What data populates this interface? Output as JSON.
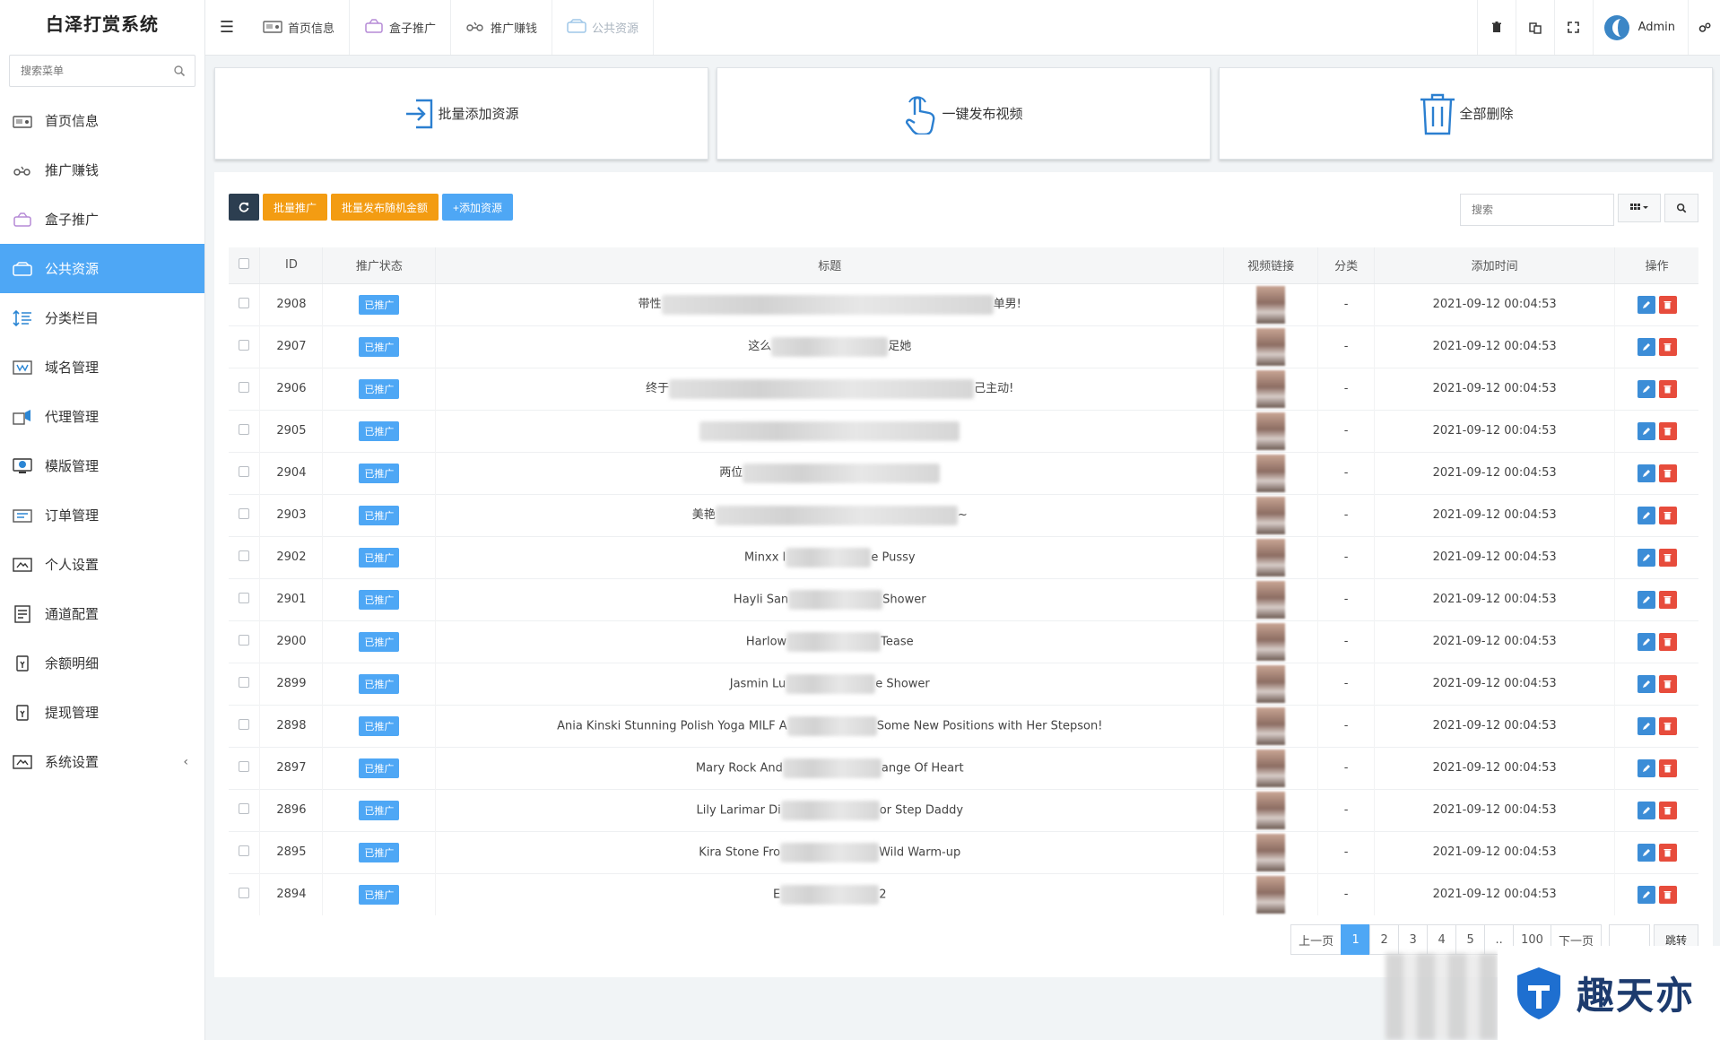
{
  "app": {
    "title": "白泽打赏系统"
  },
  "sidebar": {
    "search_placeholder": "搜索菜单",
    "items": [
      {
        "label": "首页信息",
        "icon": "dashboard-icon",
        "active": false
      },
      {
        "label": "推广赚钱",
        "icon": "promote-icon",
        "active": false
      },
      {
        "label": "盒子推广",
        "icon": "box-icon",
        "active": false
      },
      {
        "label": "公共资源",
        "icon": "resource-icon",
        "active": true
      },
      {
        "label": "分类栏目",
        "icon": "category-icon",
        "active": false
      },
      {
        "label": "域名管理",
        "icon": "domain-icon",
        "active": false
      },
      {
        "label": "代理管理",
        "icon": "agent-icon",
        "active": false
      },
      {
        "label": "模版管理",
        "icon": "template-icon",
        "active": false
      },
      {
        "label": "订单管理",
        "icon": "order-icon",
        "active": false
      },
      {
        "label": "个人设置",
        "icon": "profile-icon",
        "active": false
      },
      {
        "label": "通道配置",
        "icon": "channel-icon",
        "active": false
      },
      {
        "label": "余额明细",
        "icon": "balance-icon",
        "active": false
      },
      {
        "label": "提现管理",
        "icon": "withdraw-icon",
        "active": false
      },
      {
        "label": "系统设置",
        "icon": "settings-icon",
        "active": false,
        "has_submenu": true
      }
    ]
  },
  "topbar": {
    "tabs": [
      {
        "label": "首页信息",
        "icon": "dashboard-icon"
      },
      {
        "label": "盒子推广",
        "icon": "box-icon"
      },
      {
        "label": "推广赚钱",
        "icon": "promote-icon"
      },
      {
        "label": "公共资源",
        "icon": "resource-icon",
        "current": true
      }
    ],
    "user": "Admin"
  },
  "quick_actions": [
    {
      "label": "批量添加资源",
      "icon": "import-icon"
    },
    {
      "label": "一键发布视频",
      "icon": "tap-icon"
    },
    {
      "label": "全部删除",
      "icon": "trash-icon"
    }
  ],
  "toolbar": {
    "batch_promote": "批量推广",
    "batch_publish_random": "批量发布随机金额",
    "add_resource": "+添加资源",
    "search_placeholder": "搜索"
  },
  "table": {
    "columns": [
      "ID",
      "推广状态",
      "标题",
      "视频链接",
      "分类",
      "添加时间",
      "操作"
    ],
    "rows": [
      {
        "id": "2908",
        "status": "已推广",
        "title_pre": "带性",
        "title_post": "单男!",
        "blur_w": 370,
        "category": "-",
        "time": "2021-09-12 00:04:53"
      },
      {
        "id": "2907",
        "status": "已推广",
        "title_pre": "这么",
        "title_post": "足她",
        "blur_w": 130,
        "category": "-",
        "time": "2021-09-12 00:04:53"
      },
      {
        "id": "2906",
        "status": "已推广",
        "title_pre": "终于",
        "title_post": "己主动!",
        "blur_w": 340,
        "category": "-",
        "time": "2021-09-12 00:04:53"
      },
      {
        "id": "2905",
        "status": "已推广",
        "title_pre": "",
        "title_post": "",
        "blur_w": 290,
        "category": "-",
        "time": "2021-09-12 00:04:53"
      },
      {
        "id": "2904",
        "status": "已推广",
        "title_pre": "两位",
        "title_post": "",
        "blur_w": 220,
        "category": "-",
        "time": "2021-09-12 00:04:53"
      },
      {
        "id": "2903",
        "status": "已推广",
        "title_pre": "美艳",
        "title_post": "~",
        "blur_w": 270,
        "category": "-",
        "time": "2021-09-12 00:04:53"
      },
      {
        "id": "2902",
        "status": "已推广",
        "title_pre": "Minxx I",
        "title_post": "e Pussy",
        "blur_w": 95,
        "category": "-",
        "time": "2021-09-12 00:04:53"
      },
      {
        "id": "2901",
        "status": "已推广",
        "title_pre": "Hayli San",
        "title_post": "Shower",
        "blur_w": 105,
        "category": "-",
        "time": "2021-09-12 00:04:53"
      },
      {
        "id": "2900",
        "status": "已推广",
        "title_pre": "Harlow",
        "title_post": "Tease",
        "blur_w": 105,
        "category": "-",
        "time": "2021-09-12 00:04:53"
      },
      {
        "id": "2899",
        "status": "已推广",
        "title_pre": "Jasmin Lu",
        "title_post": "e Shower",
        "blur_w": 100,
        "category": "-",
        "time": "2021-09-12 00:04:53"
      },
      {
        "id": "2898",
        "status": "已推广",
        "title_pre": "Ania Kinski Stunning Polish Yoga MILF A",
        "title_post": "Some New Positions with Her Stepson!",
        "blur_w": 100,
        "category": "-",
        "time": "2021-09-12 00:04:53"
      },
      {
        "id": "2897",
        "status": "已推广",
        "title_pre": "Mary Rock And",
        "title_post": "ange Of Heart",
        "blur_w": 110,
        "category": "-",
        "time": "2021-09-12 00:04:53"
      },
      {
        "id": "2896",
        "status": "已推广",
        "title_pre": "Lily Larimar Di",
        "title_post": "or Step Daddy",
        "blur_w": 110,
        "category": "-",
        "time": "2021-09-12 00:04:53"
      },
      {
        "id": "2895",
        "status": "已推广",
        "title_pre": "Kira Stone Fro",
        "title_post": "Wild Warm-up",
        "blur_w": 110,
        "category": "-",
        "time": "2021-09-12 00:04:53"
      },
      {
        "id": "2894",
        "status": "已推广",
        "title_pre": "E",
        "title_post": "2",
        "blur_w": 110,
        "category": "-",
        "time": "2021-09-12 00:04:53"
      }
    ]
  },
  "pagination": {
    "prev": "上一页",
    "pages": [
      "1",
      "2",
      "3",
      "4",
      "5",
      "..",
      "100"
    ],
    "current": "1",
    "next": "下一页",
    "jump": "跳转"
  },
  "watermark": {
    "text": "趣天亦"
  }
}
